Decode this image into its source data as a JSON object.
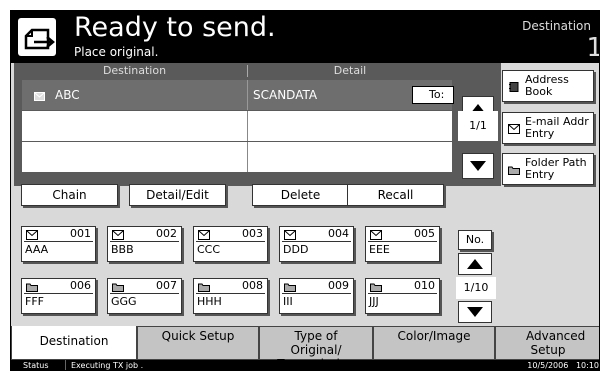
{
  "header": {
    "title": "Ready to send.",
    "subtitle": "Place original.",
    "destination_label": "Destination",
    "destination_count": "1"
  },
  "dest_table": {
    "col_destination": "Destination",
    "col_detail": "Detail",
    "row1_name": "ABC",
    "row1_detail": "SCANDATA",
    "row1_to": "To:",
    "page_indicator": "1/1"
  },
  "side_buttons": {
    "address_book": "Address Book",
    "email": "E-mail Addr Entry",
    "folder": "Folder Path Entry"
  },
  "actions": {
    "chain": "Chain",
    "detail_edit": "Detail/Edit",
    "delete": "Delete",
    "recall": "Recall"
  },
  "one_touch": [
    {
      "num": "001",
      "name": "AAA",
      "icon": "email-icon"
    },
    {
      "num": "002",
      "name": "BBB",
      "icon": "email-icon"
    },
    {
      "num": "003",
      "name": "CCC",
      "icon": "email-icon"
    },
    {
      "num": "004",
      "name": "DDD",
      "icon": "email-icon"
    },
    {
      "num": "005",
      "name": "EEE",
      "icon": "email-icon"
    },
    {
      "num": "006",
      "name": "FFF",
      "icon": "folder-icon"
    },
    {
      "num": "007",
      "name": "GGG",
      "icon": "folder-icon"
    },
    {
      "num": "008",
      "name": "HHH",
      "icon": "folder-icon"
    },
    {
      "num": "009",
      "name": "III",
      "icon": "folder-icon"
    },
    {
      "num": "010",
      "name": "JJJ",
      "icon": "folder-icon"
    }
  ],
  "one_touch_nav": {
    "no_label": "No.",
    "page": "1/10"
  },
  "tabs": [
    {
      "label": "Destination"
    },
    {
      "label": "Quick Setup"
    },
    {
      "label": "Type of Original/ Transmission"
    },
    {
      "label": "Color/Image"
    },
    {
      "label": "Advanced Setup"
    }
  ],
  "status": {
    "label": "Status",
    "message": "Executing TX job .",
    "datetime": "10/5/2006   10:10"
  },
  "colors": {
    "header_bg": "#000000",
    "panel_bg": "#5a5a5a",
    "screen_bg": "#d9d9d9"
  }
}
